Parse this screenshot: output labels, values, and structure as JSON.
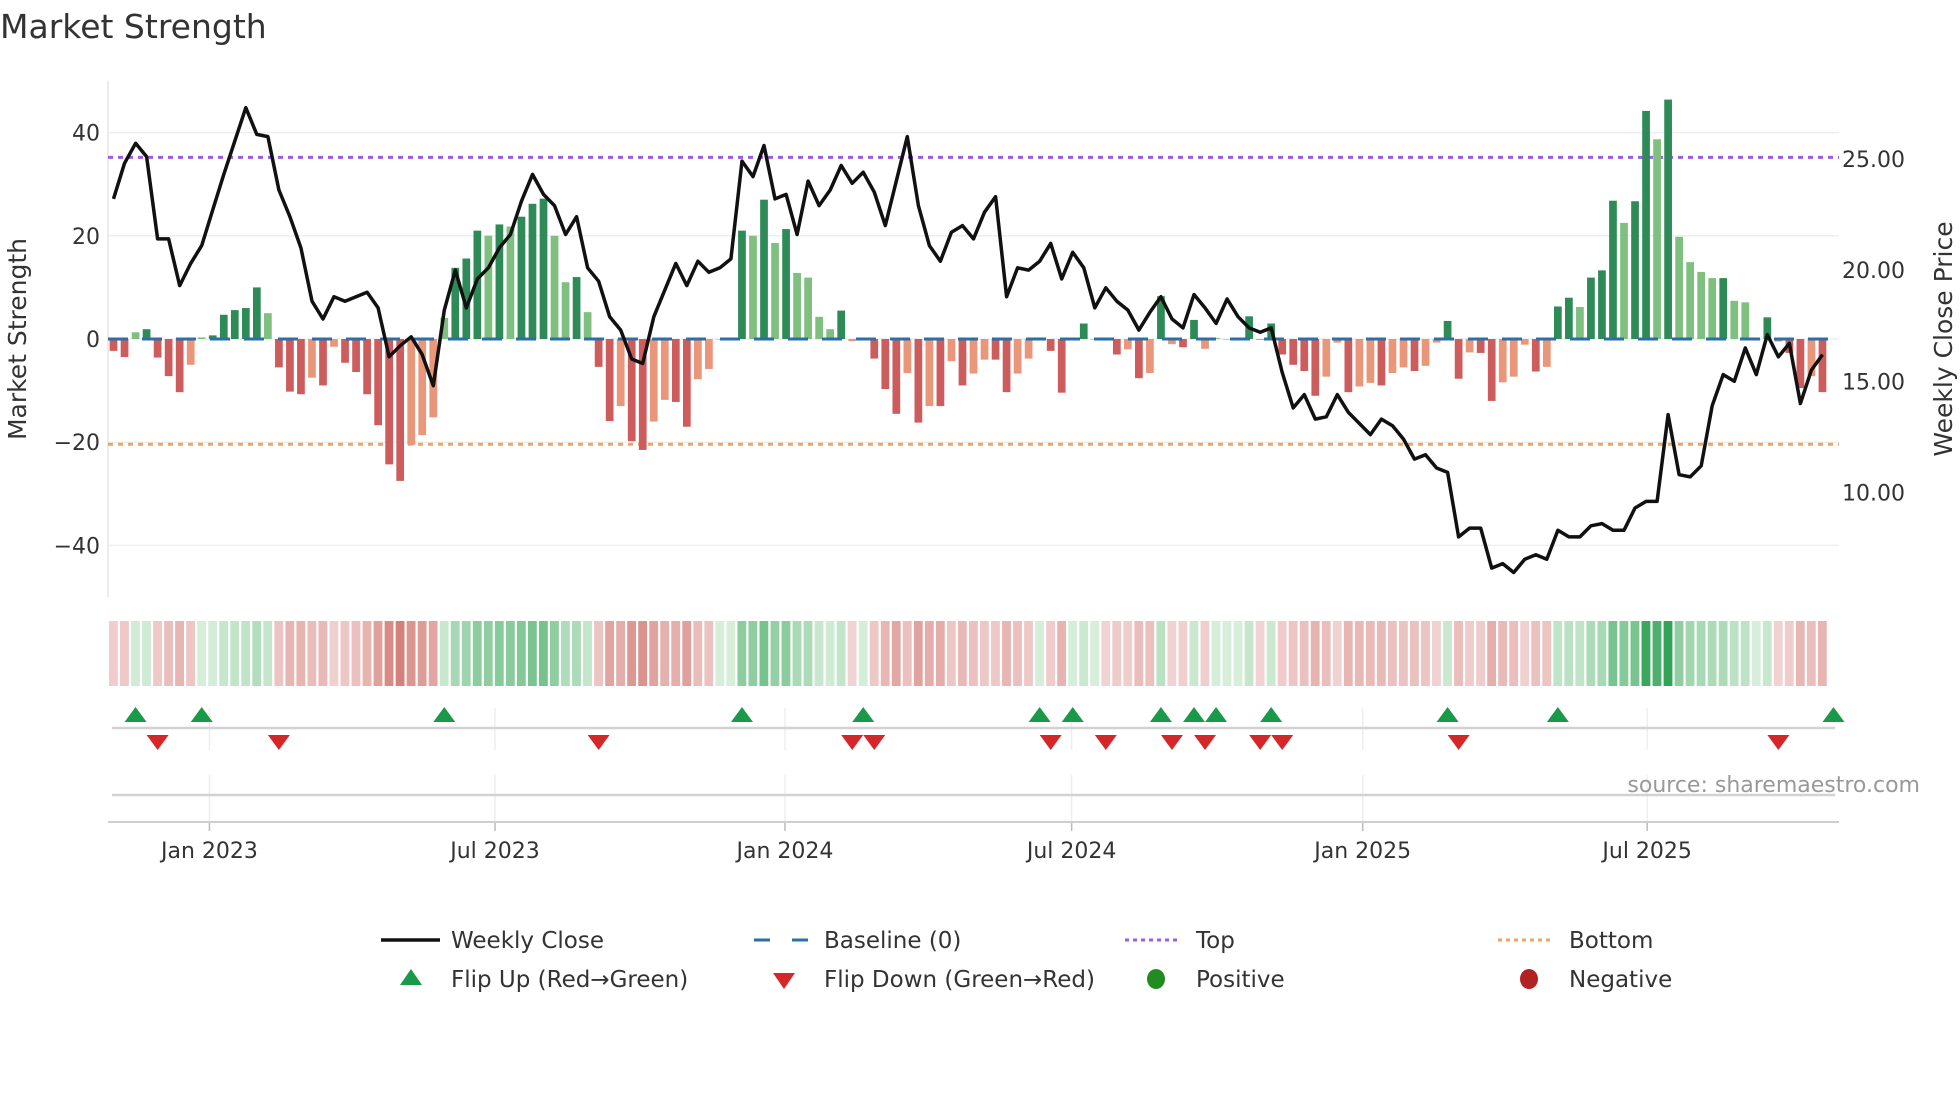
{
  "chart_data": {
    "type": "bar",
    "title": "Market Strength",
    "ylabel": "Market Strength",
    "y2label": "Weekly Close Price",
    "interval": "weekly",
    "ylim": [
      -50,
      50
    ],
    "y2lim": [
      5.3,
      28.5
    ],
    "grid": true,
    "yticks": [
      "40",
      "20",
      "0",
      "−20",
      "−40"
    ],
    "ytick_values": [
      40,
      20,
      0,
      -20,
      -40
    ],
    "y2ticks": [
      "25.00",
      "20.00",
      "15.00",
      "10.00"
    ],
    "y2tick_values": [
      25,
      20,
      15,
      10
    ],
    "xticks": [
      {
        "label": "Jan 2023",
        "week": 8.7
      },
      {
        "label": "Jul 2023",
        "week": 34.6
      },
      {
        "label": "Jan 2024",
        "week": 60.9
      },
      {
        "label": "Jul 2024",
        "week": 86.9
      },
      {
        "label": "Jan 2025",
        "week": 113.3
      },
      {
        "label": "Jul 2025",
        "week": 139.1
      }
    ],
    "top_threshold": 35.2,
    "bottom_threshold": -20.4,
    "baseline": 0,
    "strength": [
      -2.3,
      -3.5,
      1.3,
      1.9,
      -3.6,
      -7.2,
      -10.3,
      -5,
      0.3,
      0.7,
      4.7,
      5.6,
      6,
      10,
      5,
      -5.5,
      -10.2,
      -10.7,
      -7.5,
      -9,
      -1.5,
      -4.6,
      -6.4,
      -10.7,
      -16.7,
      -24.3,
      -27.5,
      -20.5,
      -18.6,
      -15.2,
      4.1,
      13.8,
      15.6,
      21,
      20,
      22.2,
      21.8,
      23.7,
      26.2,
      27.2,
      20,
      11,
      12,
      5.2,
      -5.4,
      -15.9,
      -13,
      -19.8,
      -21.5,
      -16,
      -11.8,
      -12.2,
      -17,
      -7.8,
      -5.8,
      0,
      0,
      21,
      20,
      27,
      18.6,
      21.3,
      12.8,
      11.9,
      4.3,
      1.9,
      5.5,
      -0.4,
      0.2,
      -3.8,
      -9.7,
      -14.5,
      -6.6,
      -16.2,
      -13,
      -13,
      -4.3,
      -9,
      -6.7,
      -4,
      -4,
      -10.3,
      -6.7,
      -3.8,
      0.3,
      -2.3,
      -10.4,
      0.2,
      3,
      0,
      -0.3,
      -3,
      -2,
      -7.6,
      -6.6,
      8.3,
      -1,
      -1.6,
      3.7,
      -1.9,
      0.2,
      0,
      0,
      4.4,
      -0.2,
      3,
      -3,
      -5,
      -6.2,
      -11,
      -7.3,
      -0.7,
      -10.3,
      -9.2,
      -8.5,
      -9,
      -6.6,
      -5.5,
      -6.2,
      -5.2,
      -0.7,
      3.5,
      -7.7,
      -2.6,
      -2.7,
      -12,
      -8.4,
      -7.3,
      -1.1,
      -6.3,
      -5.4,
      6.3,
      8,
      6.2,
      11.9,
      13.3,
      26.8,
      22.5,
      26.7,
      44.2,
      38.7,
      46.4,
      19.8,
      14.9,
      13,
      11.8,
      11.8,
      7.4,
      7.1,
      0,
      4.2,
      -0.5,
      -2.7,
      -9.5,
      -7.2,
      -10.3
    ],
    "weekly_close": [
      23.2,
      24.8,
      25.7,
      25.1,
      21.4,
      21.4,
      19.3,
      20.3,
      21.1,
      22.7,
      24.3,
      25.8,
      27.3,
      26.1,
      26.0,
      23.6,
      22.4,
      21.0,
      18.6,
      17.8,
      18.8,
      18.6,
      18.8,
      19.0,
      18.3,
      16.1,
      16.6,
      17.0,
      16.2,
      14.8,
      18.2,
      20.0,
      18.3,
      19.6,
      20.1,
      21.0,
      21.6,
      23.1,
      24.3,
      23.4,
      22.9,
      21.6,
      22.4,
      20.1,
      19.5,
      17.9,
      17.3,
      16.0,
      15.8,
      17.9,
      19.1,
      20.3,
      19.3,
      20.4,
      19.9,
      20.1,
      20.5,
      24.9,
      24.2,
      25.6,
      23.2,
      23.4,
      21.6,
      24.0,
      22.9,
      23.6,
      24.7,
      23.9,
      24.4,
      23.5,
      22.0,
      24.0,
      26.0,
      22.9,
      21.1,
      20.4,
      21.7,
      22.0,
      21.4,
      22.6,
      23.3,
      18.8,
      20.1,
      20.0,
      20.4,
      21.2,
      19.6,
      20.8,
      20.1,
      18.3,
      19.2,
      18.6,
      18.2,
      17.3,
      18.1,
      18.8,
      17.8,
      17.4,
      18.9,
      18.3,
      17.6,
      18.7,
      17.9,
      17.4,
      17.2,
      17.4,
      15.4,
      13.8,
      14.4,
      13.3,
      13.4,
      14.4,
      13.6,
      13.1,
      12.6,
      13.3,
      13.0,
      12.4,
      11.5,
      11.7,
      11.1,
      10.9,
      8.0,
      8.4,
      8.4,
      6.6,
      6.8,
      6.4,
      7.0,
      7.2,
      7.0,
      8.3,
      8.0,
      8.0,
      8.5,
      8.6,
      8.3,
      8.3,
      9.3,
      9.6,
      9.6,
      13.5,
      10.8,
      10.7,
      11.2,
      13.9,
      15.3,
      15.0,
      16.5,
      15.3,
      17.1,
      16.1,
      16.7,
      14.0,
      15.5,
      16.2
    ],
    "flip_up_weeks": [
      2,
      8,
      30,
      57,
      68,
      84,
      87,
      95,
      98,
      100,
      105,
      121,
      131,
      156
    ],
    "flip_down_weeks": [
      4,
      15,
      44,
      67,
      69,
      85,
      90,
      96,
      99,
      104,
      106,
      122,
      151
    ],
    "legend": {
      "weekly_close": "Weekly Close",
      "baseline": "Baseline (0)",
      "top": "Top",
      "bottom": "Bottom",
      "flip_up": "Flip Up (Red→Green)",
      "flip_down": "Flip Down (Green→Red)",
      "positive": "Positive",
      "negative": "Negative"
    },
    "legend_placement": "bottom",
    "source": "source: sharemaestro.com"
  },
  "colors": {
    "pos_strong": "#2e8b57",
    "pos_weak": "#7fbf7f",
    "neg_strong": "#cd5c5c",
    "neg_weak": "#e9967a",
    "line": "#111111",
    "baseline": "#2c6fa6",
    "top": "#9b5de5",
    "bottom": "#f4a261",
    "flip_up": "#1a9a48",
    "flip_down": "#d62728",
    "positive": "#228b22",
    "negative": "#b22222"
  }
}
